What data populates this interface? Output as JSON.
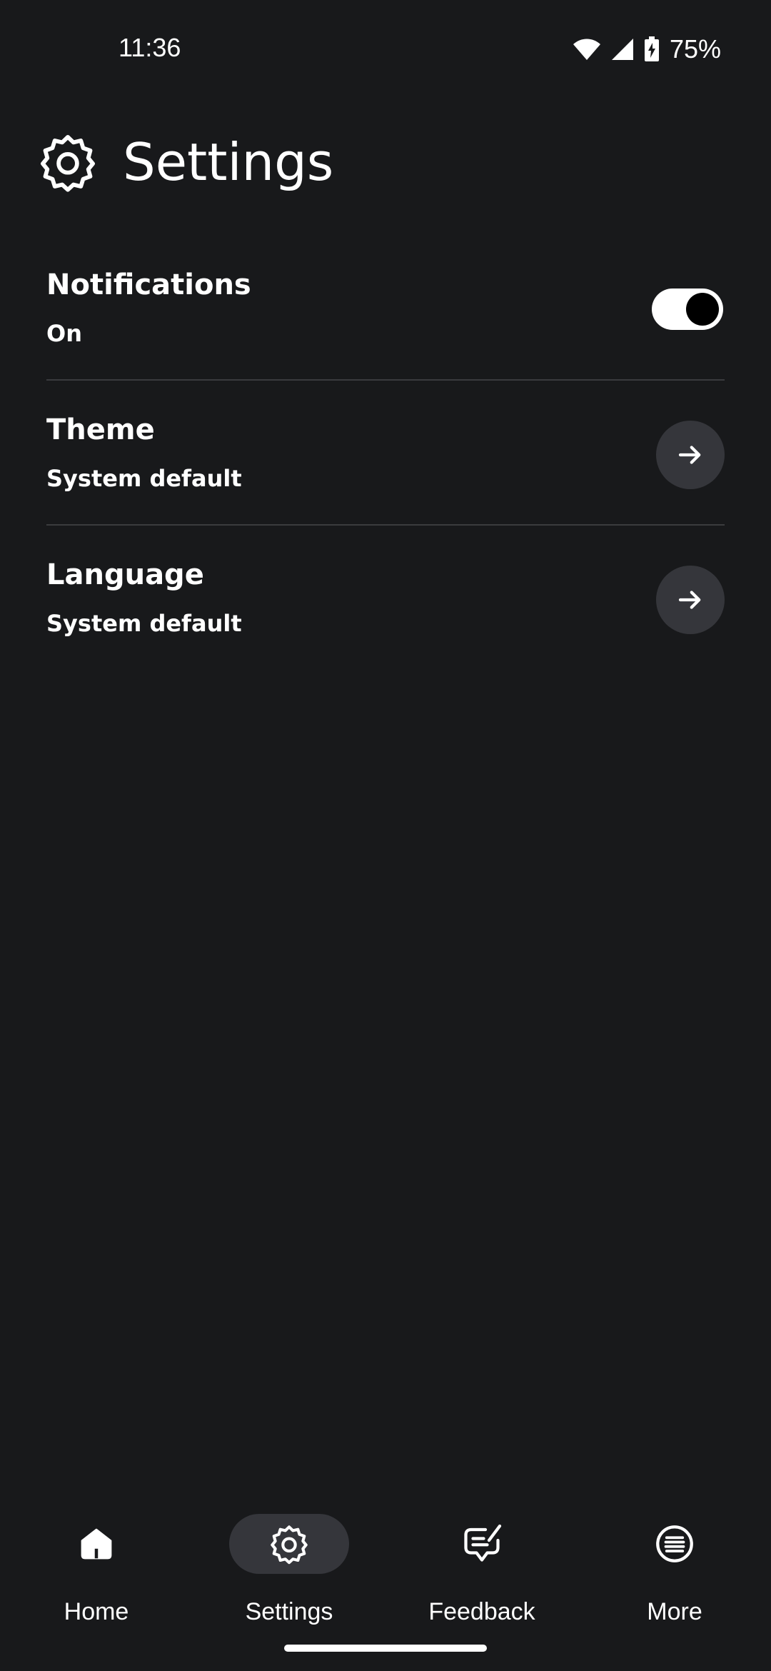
{
  "status_bar": {
    "time": "11:36",
    "battery_text": "75%",
    "icons": [
      "wifi-icon",
      "cell-signal-icon",
      "battery-charging-icon"
    ]
  },
  "header": {
    "title": "Settings",
    "icon": "gear-icon"
  },
  "settings": {
    "items": [
      {
        "title": "Notifications",
        "value": "On",
        "control": "toggle",
        "toggle_on": true
      },
      {
        "title": "Theme",
        "value": "System default",
        "control": "arrow-right-icon"
      },
      {
        "title": "Language",
        "value": "System default",
        "control": "arrow-right-icon"
      }
    ]
  },
  "bottom_nav": {
    "items": [
      {
        "label": "Home",
        "icon": "home-icon",
        "active": false
      },
      {
        "label": "Settings",
        "icon": "gear-icon",
        "active": true
      },
      {
        "label": "Feedback",
        "icon": "feedback-icon",
        "active": false
      },
      {
        "label": "More",
        "icon": "menu-list-icon",
        "active": false
      }
    ]
  },
  "colors": {
    "background": "#18191b",
    "surface": "#35363b",
    "divider": "#3a3b3e",
    "text": "#ffffff"
  }
}
